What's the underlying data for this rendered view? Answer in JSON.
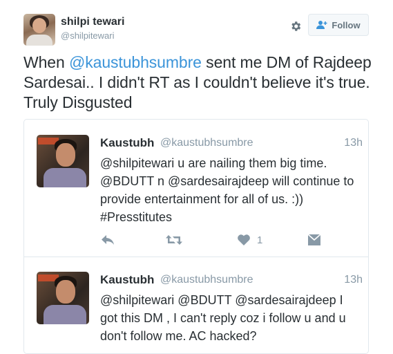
{
  "author": {
    "name": "shilpi tewari",
    "handle": "@shilpitewari",
    "follow_label": "Follow"
  },
  "tweet": {
    "text_before": "When ",
    "mention": "@kaustubhsumbre",
    "text_after": " sent me DM of Rajdeep Sardesai.. I didn't RT as I couldn't believe it's true. Truly Disgusted"
  },
  "quoted": [
    {
      "name": "Kaustubh",
      "handle": "@kaustubhsumbre",
      "time": "13h",
      "text": "@shilpitewari u are nailing them big time. @BDUTT n @sardesairajdeep will continue to provide entertainment for all of us. :)) #Presstitutes",
      "likes": "1"
    },
    {
      "name": "Kaustubh",
      "handle": "@kaustubhsumbre",
      "time": "13h",
      "text": "@shilpitewari @BDUTT @sardesairajdeep I got this DM , I can't reply coz i follow u and u don't follow me. AC hacked?"
    }
  ],
  "icons": {
    "settings": "gear-icon",
    "follow": "add-user-icon",
    "reply": "reply-icon",
    "retweet": "retweet-icon",
    "like": "heart-icon",
    "dm": "envelope-icon"
  },
  "colors": {
    "link": "#3b94d9",
    "meta": "#8899a6",
    "text": "#292f33"
  }
}
